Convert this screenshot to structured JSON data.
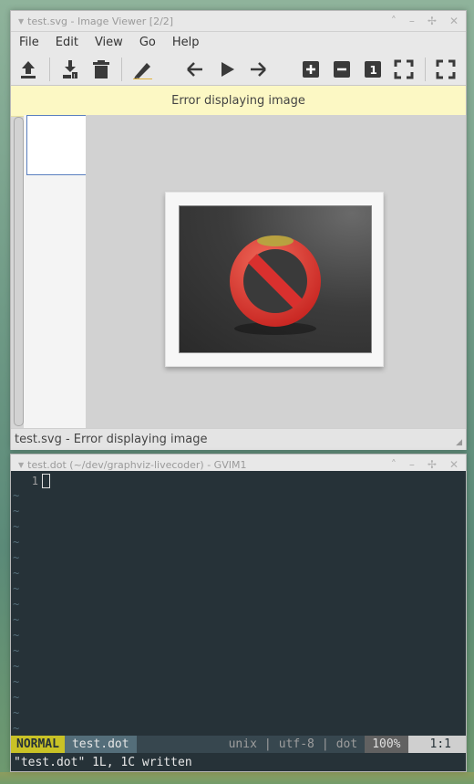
{
  "viewer": {
    "window_title": "test.svg - Image Viewer [2/2]",
    "menu": [
      "File",
      "Edit",
      "View",
      "Go",
      "Help"
    ],
    "toolbar": {
      "icons": [
        "upload-icon",
        "download-icon",
        "trash-icon",
        "pencil-icon",
        "arrow-left-icon",
        "play-icon",
        "arrow-right-icon",
        "zoom-in-icon",
        "zoom-out-icon",
        "zoom-1-icon",
        "fit-icon",
        "fullscreen-icon"
      ],
      "zoom_one_label": "1"
    },
    "banner": "Error displaying image",
    "status": "test.svg - Error displaying image"
  },
  "gvim": {
    "window_title": "test.dot (~/dev/graphviz-livecoder) - GVIM1",
    "line_number": "1",
    "tilde": "~",
    "statusline": {
      "mode": "NORMAL",
      "filename": "test.dot",
      "fileformat": "unix",
      "sep": "|",
      "encoding": "utf-8",
      "filetype": "dot",
      "percent": "100%",
      "position": "1:1"
    },
    "message": "\"test.dot\" 1L, 1C written"
  },
  "colors": {
    "banner_bg": "#fcf8c4",
    "vim_bg": "#263238",
    "mode_bg": "#c9c226",
    "error_red": "#d9302e"
  }
}
